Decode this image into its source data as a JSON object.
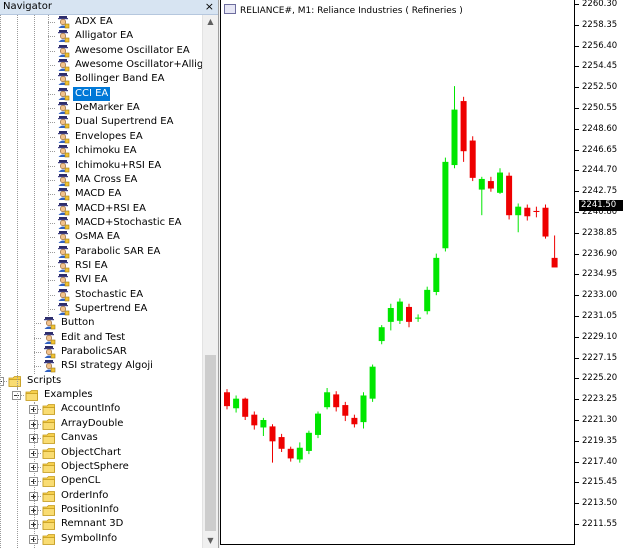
{
  "navigator": {
    "title": "Navigator",
    "close_label": "×",
    "items": [
      {
        "label": "ADX EA",
        "level": 3,
        "type": "ea"
      },
      {
        "label": "Alligator EA",
        "level": 3,
        "type": "ea"
      },
      {
        "label": "Awesome Oscillator EA",
        "level": 3,
        "type": "ea"
      },
      {
        "label": "Awesome Oscillator+Alligato",
        "level": 3,
        "type": "ea"
      },
      {
        "label": "Bollinger Band EA",
        "level": 3,
        "type": "ea"
      },
      {
        "label": "CCI EA",
        "level": 3,
        "type": "ea",
        "selected": true
      },
      {
        "label": "DeMarker EA",
        "level": 3,
        "type": "ea"
      },
      {
        "label": "Dual Supertrend EA",
        "level": 3,
        "type": "ea"
      },
      {
        "label": "Envelopes EA",
        "level": 3,
        "type": "ea"
      },
      {
        "label": "Ichimoku EA",
        "level": 3,
        "type": "ea"
      },
      {
        "label": "Ichimoku+RSI EA",
        "level": 3,
        "type": "ea"
      },
      {
        "label": "MA Cross EA",
        "level": 3,
        "type": "ea"
      },
      {
        "label": "MACD EA",
        "level": 3,
        "type": "ea"
      },
      {
        "label": "MACD+RSI EA",
        "level": 3,
        "type": "ea"
      },
      {
        "label": "MACD+Stochastic EA",
        "level": 3,
        "type": "ea"
      },
      {
        "label": "OsMA EA",
        "level": 3,
        "type": "ea"
      },
      {
        "label": "Parabolic SAR EA",
        "level": 3,
        "type": "ea"
      },
      {
        "label": "RSI EA",
        "level": 3,
        "type": "ea"
      },
      {
        "label": "RVI EA",
        "level": 3,
        "type": "ea"
      },
      {
        "label": "Stochastic EA",
        "level": 3,
        "type": "ea"
      },
      {
        "label": "Supertrend EA",
        "level": 3,
        "type": "ea"
      },
      {
        "label": "Button",
        "level": 2,
        "type": "ea"
      },
      {
        "label": "Edit and Test",
        "level": 2,
        "type": "ea"
      },
      {
        "label": "ParabolicSAR",
        "level": 2,
        "type": "ea"
      },
      {
        "label": "RSI strategy Algoji",
        "level": 2,
        "type": "ea"
      },
      {
        "label": "Scripts",
        "level": 0,
        "type": "folder",
        "expander": "minus"
      },
      {
        "label": "Examples",
        "level": 1,
        "type": "folder",
        "expander": "minus"
      },
      {
        "label": "AccountInfo",
        "level": 2,
        "type": "folder",
        "expander": "plus"
      },
      {
        "label": "ArrayDouble",
        "level": 2,
        "type": "folder",
        "expander": "plus"
      },
      {
        "label": "Canvas",
        "level": 2,
        "type": "folder",
        "expander": "plus"
      },
      {
        "label": "ObjectChart",
        "level": 2,
        "type": "folder",
        "expander": "plus"
      },
      {
        "label": "ObjectSphere",
        "level": 2,
        "type": "folder",
        "expander": "plus"
      },
      {
        "label": "OpenCL",
        "level": 2,
        "type": "folder",
        "expander": "plus"
      },
      {
        "label": "OrderInfo",
        "level": 2,
        "type": "folder",
        "expander": "plus"
      },
      {
        "label": "PositionInfo",
        "level": 2,
        "type": "folder",
        "expander": "plus"
      },
      {
        "label": "Remnant 3D",
        "level": 2,
        "type": "folder",
        "expander": "plus"
      },
      {
        "label": "SymbolInfo",
        "level": 2,
        "type": "folder",
        "expander": "plus"
      }
    ]
  },
  "chart": {
    "title": "RELIANCE#, M1:  Reliance Industries ( Refineries )",
    "current_price_label": "2241.50",
    "current_price": 2241.5,
    "y_labels": [
      "2260.30",
      "2258.35",
      "2256.40",
      "2254.45",
      "2252.50",
      "2250.55",
      "2248.60",
      "2246.65",
      "2244.70",
      "2242.75",
      "2240.80",
      "2238.85",
      "2236.90",
      "2234.95",
      "2233.00",
      "2231.05",
      "2229.10",
      "2227.15",
      "2225.20",
      "2223.25",
      "2221.30",
      "2219.35",
      "2217.40",
      "2215.45",
      "2213.50",
      "2211.55"
    ],
    "colors": {
      "bull": "#00e600",
      "bear": "#ee0000",
      "wick": "#000000"
    }
  },
  "chart_data": {
    "type": "candlestick",
    "ylim": [
      2210.6,
      2260.3
    ],
    "candles": [
      {
        "o": 2223.9,
        "h": 2224.2,
        "l": 2222.3,
        "c": 2222.6
      },
      {
        "o": 2222.4,
        "h": 2223.6,
        "l": 2222.0,
        "c": 2223.3
      },
      {
        "o": 2223.3,
        "h": 2223.4,
        "l": 2221.3,
        "c": 2221.6
      },
      {
        "o": 2221.8,
        "h": 2222.1,
        "l": 2220.4,
        "c": 2220.8
      },
      {
        "o": 2220.6,
        "h": 2221.5,
        "l": 2219.8,
        "c": 2221.3
      },
      {
        "o": 2220.7,
        "h": 2220.9,
        "l": 2217.3,
        "c": 2219.3
      },
      {
        "o": 2219.7,
        "h": 2220.0,
        "l": 2218.3,
        "c": 2218.6
      },
      {
        "o": 2218.6,
        "h": 2218.8,
        "l": 2217.4,
        "c": 2217.7
      },
      {
        "o": 2217.6,
        "h": 2219.2,
        "l": 2217.3,
        "c": 2218.7
      },
      {
        "o": 2218.4,
        "h": 2220.3,
        "l": 2218.1,
        "c": 2220.1
      },
      {
        "o": 2219.9,
        "h": 2222.1,
        "l": 2219.6,
        "c": 2221.9
      },
      {
        "o": 2222.5,
        "h": 2224.3,
        "l": 2222.3,
        "c": 2223.9
      },
      {
        "o": 2223.7,
        "h": 2224.0,
        "l": 2222.1,
        "c": 2222.5
      },
      {
        "o": 2222.7,
        "h": 2223.0,
        "l": 2221.2,
        "c": 2221.7
      },
      {
        "o": 2221.5,
        "h": 2221.8,
        "l": 2220.6,
        "c": 2220.9
      },
      {
        "o": 2221.1,
        "h": 2223.9,
        "l": 2220.5,
        "c": 2223.6
      },
      {
        "o": 2223.3,
        "h": 2226.5,
        "l": 2223.0,
        "c": 2226.3
      },
      {
        "o": 2228.7,
        "h": 2230.2,
        "l": 2228.4,
        "c": 2230.0
      },
      {
        "o": 2230.5,
        "h": 2232.2,
        "l": 2229.7,
        "c": 2231.8
      },
      {
        "o": 2230.6,
        "h": 2232.7,
        "l": 2230.3,
        "c": 2232.4
      },
      {
        "o": 2231.9,
        "h": 2232.2,
        "l": 2230.0,
        "c": 2230.5
      },
      {
        "o": 2230.8,
        "h": 2231.2,
        "l": 2230.5,
        "c": 2230.9
      },
      {
        "o": 2231.5,
        "h": 2233.8,
        "l": 2231.2,
        "c": 2233.5
      },
      {
        "o": 2233.3,
        "h": 2236.9,
        "l": 2233.0,
        "c": 2236.5
      },
      {
        "o": 2237.4,
        "h": 2245.9,
        "l": 2237.1,
        "c": 2245.5
      },
      {
        "o": 2245.2,
        "h": 2252.6,
        "l": 2244.9,
        "c": 2250.4
      },
      {
        "o": 2251.2,
        "h": 2251.6,
        "l": 2245.5,
        "c": 2246.5
      },
      {
        "o": 2247.5,
        "h": 2247.9,
        "l": 2243.7,
        "c": 2244.0
      },
      {
        "o": 2242.9,
        "h": 2244.1,
        "l": 2240.5,
        "c": 2243.9
      },
      {
        "o": 2243.7,
        "h": 2244.1,
        "l": 2242.7,
        "c": 2243.0
      },
      {
        "o": 2242.6,
        "h": 2244.9,
        "l": 2242.5,
        "c": 2244.5
      },
      {
        "o": 2244.2,
        "h": 2244.5,
        "l": 2240.1,
        "c": 2240.5
      },
      {
        "o": 2240.5,
        "h": 2241.6,
        "l": 2238.9,
        "c": 2241.3
      },
      {
        "o": 2241.2,
        "h": 2241.5,
        "l": 2240.0,
        "c": 2240.4
      },
      {
        "o": 2240.9,
        "h": 2241.3,
        "l": 2240.3,
        "c": 2240.8
      },
      {
        "o": 2241.2,
        "h": 2241.5,
        "l": 2238.3,
        "c": 2238.5
      },
      {
        "o": 2236.5,
        "h": 2238.6,
        "l": 2236.1,
        "c": 2235.6
      }
    ]
  }
}
